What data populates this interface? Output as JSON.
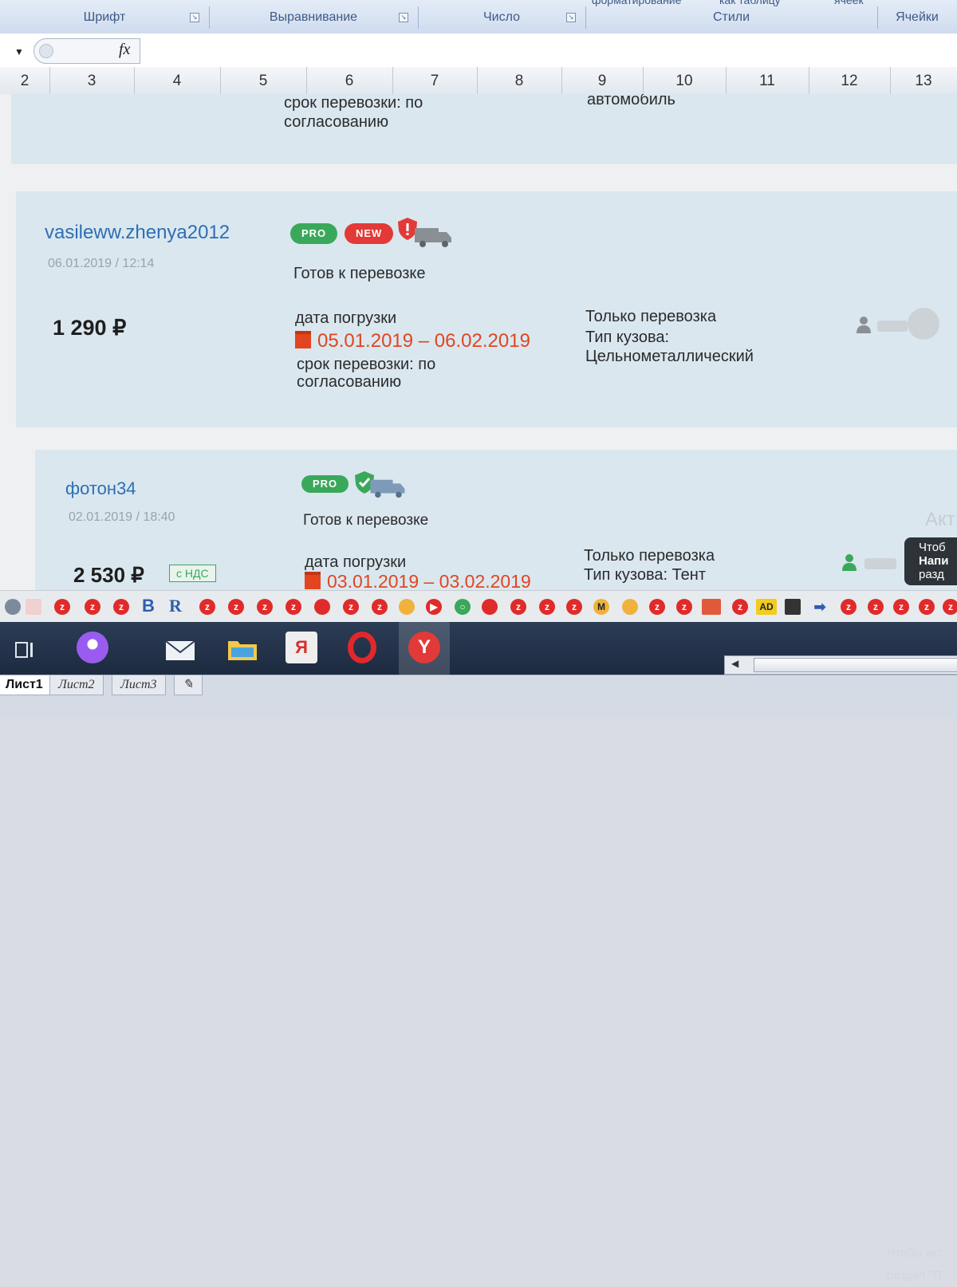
{
  "ribbon": {
    "groups": [
      "Шрифт",
      "Выравнивание",
      "Число",
      "Стили",
      "Ячейки"
    ],
    "top_labels": [
      "форматирование",
      "как таблицу",
      "ячеек"
    ]
  },
  "formula_bar": {
    "fx_label": "fx"
  },
  "columns": [
    "2",
    "3",
    "4",
    "5",
    "6",
    "7",
    "8",
    "9",
    "10",
    "11",
    "12",
    "13"
  ],
  "prev_listing": {
    "term_line1": "срок перевозки: по",
    "term_line2": "согласованию",
    "vehicle": "автомобиль"
  },
  "listings": [
    {
      "username": "vasileww.zhenya2012",
      "datetime": "06.01.2019 / 12:14",
      "price": "1 290 ₽",
      "badges": [
        "PRO",
        "NEW"
      ],
      "status": "Готов к перевозке",
      "load_label": "дата погрузки",
      "dates": "05.01.2019 – 06.02.2019",
      "term_line1": "срок перевозки: по",
      "term_line2": "согласованию",
      "service": "Только перевозка",
      "body_label": "Тип кузова:",
      "body_value": "Цельнометаллический",
      "shield_color": "#e23a38"
    },
    {
      "username": "фотон34",
      "datetime": "02.01.2019 / 18:40",
      "price": "2 530 ₽",
      "vat": "с НДС",
      "badges": [
        "PRO"
      ],
      "status": "Готов к перевозке",
      "load_label": "дата погрузки",
      "dates": "03.01.2019 – 03.02.2019",
      "service": "Только перевозка",
      "body_label": "Тип кузова: Тент",
      "shield_color": "#3aa85a"
    }
  ],
  "tooltip": {
    "line1": "Чтоб",
    "line2": "Напи",
    "line3": "разд"
  },
  "ghost_text": "Акт",
  "bookmarks": {
    "b_label": "B",
    "r_label": "R",
    "ad_label": "AD"
  },
  "windows_activation": {
    "line1": "Чтобы акт",
    "line2": "раздел \"П"
  },
  "sheet_tabs": [
    "Лист1",
    "Лист2",
    "Лист3"
  ],
  "colors": {
    "accent_link": "#2d6fb3",
    "date_red": "#e2451f",
    "pro_green": "#3aa85a",
    "new_red": "#e23a38"
  }
}
